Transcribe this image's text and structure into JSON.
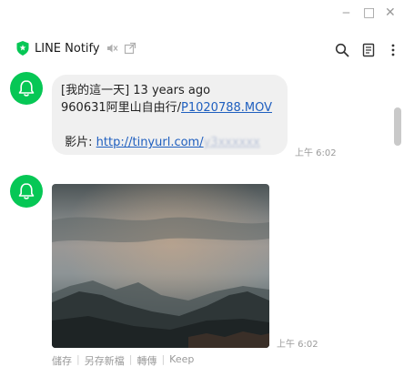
{
  "window": {
    "title": "LINE Notify",
    "controls": {
      "minimize": "‒",
      "maximize": "□",
      "close": "✕"
    }
  },
  "header": {
    "title": "LINE Notify",
    "icons": [
      "shield-icon",
      "mute-icon",
      "external-link-icon",
      "search-icon",
      "notes-icon",
      "more-icon"
    ]
  },
  "messages": [
    {
      "type": "text",
      "line1": "[我的這一天] 13 years ago",
      "line2_prefix": "960631阿里山自由行/",
      "line2_link": "P1020788.MOV",
      "line4_prefix": " 影片: ",
      "line4_link": "http://tinyurl.com/",
      "line4_blurred": "y3xxxxxx",
      "time": "上午 6:02"
    },
    {
      "type": "image",
      "description_icon": "mountain-photo",
      "time": "上午 6:02",
      "actions": [
        "儲存",
        "另存新檔",
        "轉傳",
        "Keep"
      ]
    }
  ],
  "colors": {
    "brand_green": "#06c755",
    "bubble_bg": "#f0f0f0",
    "link": "#1f5fbf",
    "muted": "#9a9a9a"
  }
}
